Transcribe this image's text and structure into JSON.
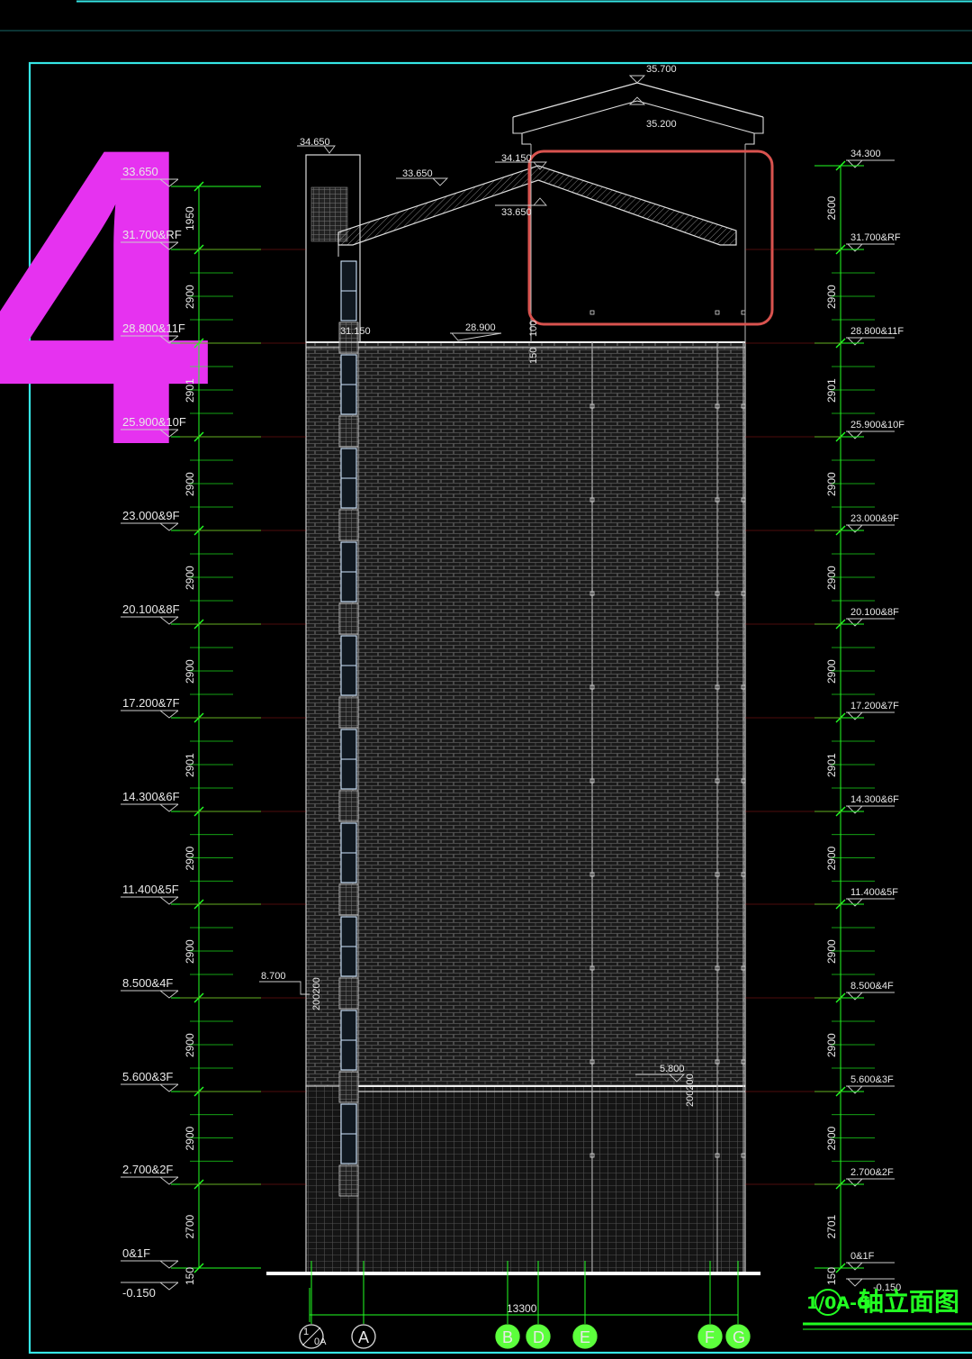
{
  "marker_glyph": "4",
  "colors": {
    "background": "#000000",
    "frame": "#35e6e6",
    "dimension": "#22ff22",
    "text": "#e8e8e8",
    "highlight": "#d9534f",
    "marker": "#e632f0",
    "axis_bubble": "#5cff3c"
  },
  "left_levels": [
    {
      "label": "33.650"
    },
    {
      "label": "31.700&RF"
    },
    {
      "label": "28.800&11F"
    },
    {
      "label": "25.900&10F"
    },
    {
      "label": "23.000&9F"
    },
    {
      "label": "20.100&8F"
    },
    {
      "label": "17.200&7F"
    },
    {
      "label": "14.300&6F"
    },
    {
      "label": "11.400&5F"
    },
    {
      "label": "8.500&4F"
    },
    {
      "label": "5.600&3F"
    },
    {
      "label": "2.700&2F"
    },
    {
      "label": "0&1F"
    },
    {
      "label": "-0.150"
    }
  ],
  "left_dims": [
    "1950",
    "2900",
    "2901",
    "2900",
    "2900",
    "2900",
    "2901",
    "2900",
    "2900",
    "2900",
    "2900",
    "2700",
    "150"
  ],
  "right_levels": [
    {
      "label": "34.300"
    },
    {
      "label": "31.700&RF"
    },
    {
      "label": "28.800&11F"
    },
    {
      "label": "25.900&10F"
    },
    {
      "label": "23.000&9F"
    },
    {
      "label": "20.100&8F"
    },
    {
      "label": "17.200&7F"
    },
    {
      "label": "14.300&6F"
    },
    {
      "label": "11.400&5F"
    },
    {
      "label": "8.500&4F"
    },
    {
      "label": "5.600&3F"
    },
    {
      "label": "2.700&2F"
    },
    {
      "label": "0&1F"
    },
    {
      "label": "-0.150"
    }
  ],
  "right_dims": [
    "2600",
    "2900",
    "2901",
    "2900",
    "2900",
    "2900",
    "2901",
    "2900",
    "2900",
    "2900",
    "2900",
    "2701",
    "150"
  ],
  "roof_labels": {
    "ridge_top": "35.700",
    "ridge_inner": "35.200",
    "parapet_left": "34.650",
    "eave_left": "33.650",
    "ridge_main": "34.150",
    "ridge_main_under": "33.650",
    "roof_floor": "28.900",
    "roof_floor_left": "31.150",
    "slab_dim_a": "100",
    "slab_dim_b": "150"
  },
  "mid_labels": {
    "canopy_left": "8.700",
    "canopy_left_dim": "200200",
    "canopy_right": "5.800",
    "canopy_right_dim": "200200"
  },
  "total_width_dim": "13300",
  "axes": [
    {
      "label": "1\n0A",
      "kind": "sub"
    },
    {
      "label": "A",
      "kind": "plain"
    },
    {
      "label": "B",
      "kind": "green"
    },
    {
      "label": "D",
      "kind": "green"
    },
    {
      "label": "E",
      "kind": "green"
    },
    {
      "label": "F",
      "kind": "green"
    },
    {
      "label": "G",
      "kind": "green"
    }
  ],
  "title": {
    "axis_range": "1/0A-G",
    "text": "轴立面图"
  }
}
